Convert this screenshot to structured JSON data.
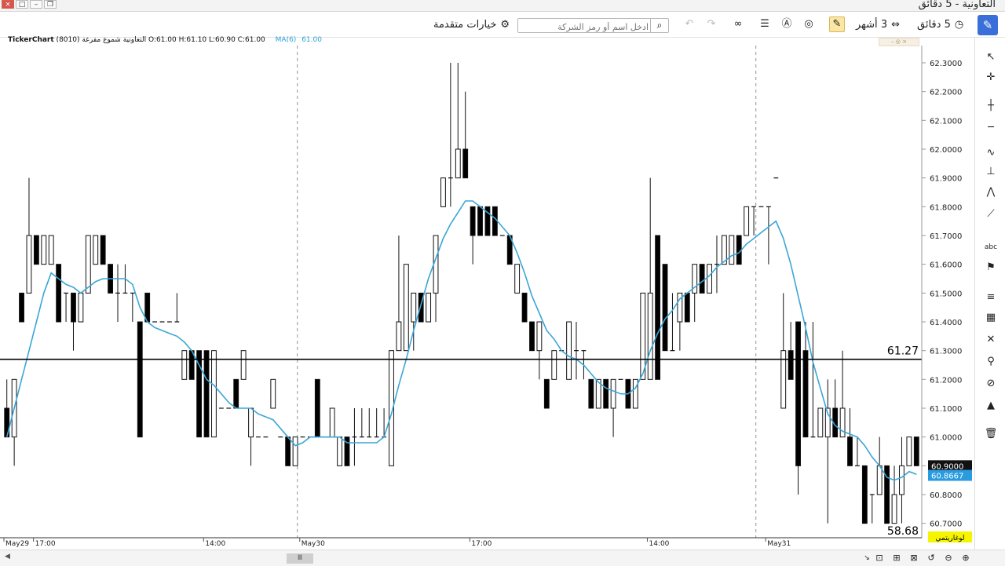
{
  "window": {
    "title": "التعاونية - 5 دقائق",
    "controls": [
      "×",
      "□",
      "–",
      "❐"
    ]
  },
  "toolbar": {
    "interval_label": "5 دقائق",
    "range_label": "3 أشهر",
    "search_placeholder": "ادخل اسم أو رمز الشركة",
    "advanced_options_label": "خيارات متقدمة",
    "icons": [
      "clock-icon",
      "range-icon",
      "draw-active-icon",
      "indicator-icon",
      "alert-icon",
      "list-icon",
      "binoculars-icon",
      "redo-icon",
      "undo-icon",
      "search-icon",
      "settings-icon"
    ]
  },
  "info": {
    "brand": "TickerChart",
    "description": "التعاونية شموع مفرغة (8010) O:61.00 H:61.10 L:60.90 C:61.00",
    "ma_label": "MA(6)",
    "ma_value": "61.00"
  },
  "sidebar_icons": [
    "cursor-icon",
    "crosshair-icon",
    "vertical-line-icon",
    "horizontal-line-icon",
    "curve-icon",
    "measure-icon",
    "pattern-icon",
    "trend-icon",
    "text-icon",
    "flag-icon",
    "layers-icon",
    "grid-icon",
    "clear-drawings-icon",
    "magnet-icon",
    "hide-icon",
    "lock-icon",
    "delete-icon"
  ],
  "bottom_icons": [
    "zoom-box-icon",
    "zoom-box2-icon",
    "zoom-fit-icon",
    "zoom-reset-icon",
    "zoom-out-icon",
    "zoom-in-icon"
  ],
  "colors": {
    "ma": "#3ba6d6",
    "price_tag": "#111111",
    "ma_tag": "#2b9be0",
    "log_tag": "#f5f500"
  },
  "chart_data": {
    "type": "candlestick",
    "subtype": "hollow",
    "ylim": [
      60.65,
      62.36
    ],
    "y_ticks": [
      "62.3000",
      "62.2000",
      "62.1000",
      "62.0000",
      "61.9000",
      "61.8000",
      "61.7000",
      "61.6000",
      "61.5000",
      "61.4000",
      "61.3000",
      "61.2000",
      "61.1000",
      "61.0000",
      "60.9000",
      "60.8000",
      "60.7000"
    ],
    "x_labels": [
      {
        "label": "May29",
        "index": 0
      },
      {
        "label": "17:00",
        "index": 4
      },
      {
        "label": "14:00",
        "index": 27
      },
      {
        "label": "May30",
        "index": 40
      },
      {
        "label": "17:00",
        "index": 63
      },
      {
        "label": "14:00",
        "index": 87
      },
      {
        "label": "May31",
        "index": 103
      }
    ],
    "day_separators": [
      40,
      102
    ],
    "hline": {
      "value": 61.27,
      "label": "61.27"
    },
    "bottom_value_label": "58.68",
    "last_price": "60.9000",
    "last_ma": "60.8667",
    "scale_mode_label": "لوغاريتمي",
    "candles": [
      [
        61.1,
        61.2,
        61.0,
        61.0
      ],
      [
        61.0,
        61.2,
        60.9,
        61.2
      ],
      [
        61.5,
        61.5,
        61.4,
        61.4
      ],
      [
        61.5,
        61.9,
        61.5,
        61.7
      ],
      [
        61.7,
        61.7,
        61.6,
        61.6
      ],
      [
        61.6,
        61.7,
        61.6,
        61.7
      ],
      [
        61.6,
        61.7,
        61.6,
        61.7
      ],
      [
        61.6,
        61.6,
        61.4,
        61.4
      ],
      [
        61.5,
        61.5,
        61.4,
        61.5
      ],
      [
        61.5,
        61.5,
        61.3,
        61.4
      ],
      [
        61.4,
        61.5,
        61.4,
        61.5
      ],
      [
        61.5,
        61.7,
        61.5,
        61.7
      ],
      [
        61.6,
        61.7,
        61.6,
        61.7
      ],
      [
        61.7,
        61.7,
        61.6,
        61.6
      ],
      [
        61.6,
        61.6,
        61.5,
        61.5
      ],
      [
        61.5,
        61.6,
        61.4,
        61.5
      ],
      [
        61.5,
        61.6,
        61.5,
        61.5
      ],
      [
        61.5,
        61.5,
        61.4,
        61.5
      ],
      [
        61.4,
        61.4,
        61.0,
        61.0
      ],
      [
        61.5,
        61.5,
        61.4,
        61.4
      ],
      [
        61.4,
        61.4,
        61.4,
        61.4
      ],
      [
        61.4,
        61.4,
        61.4,
        61.4
      ],
      [
        61.4,
        61.4,
        61.4,
        61.4
      ],
      [
        61.4,
        61.5,
        61.4,
        61.4
      ],
      [
        61.2,
        61.3,
        61.2,
        61.3
      ],
      [
        61.3,
        61.3,
        61.2,
        61.2
      ],
      [
        61.3,
        61.3,
        61.0,
        61.0
      ],
      [
        61.3,
        61.3,
        61.0,
        61.0
      ],
      [
        61.0,
        61.3,
        61.0,
        61.3
      ],
      [
        61.1,
        61.1,
        61.1,
        61.1
      ],
      [
        61.1,
        61.1,
        61.1,
        61.1
      ],
      [
        61.2,
        61.2,
        61.1,
        61.1
      ],
      [
        61.2,
        61.3,
        61.2,
        61.3
      ],
      [
        61.0,
        61.1,
        60.9,
        61.1
      ],
      [
        61.0,
        61.0,
        61.0,
        61.0
      ],
      [
        61.0,
        61.0,
        61.0,
        61.0
      ],
      [
        61.1,
        61.2,
        61.1,
        61.2
      ],
      [
        61.0,
        61.0,
        61.0,
        61.0
      ],
      [
        61.0,
        61.0,
        60.9,
        60.9
      ],
      [
        60.9,
        61.0,
        60.9,
        61.0
      ],
      [
        61.0,
        61.0,
        61.0,
        61.0
      ],
      [
        61.0,
        61.0,
        61.0,
        61.0
      ],
      [
        61.2,
        61.2,
        61.0,
        61.0
      ],
      [
        61.0,
        61.0,
        61.0,
        61.0
      ],
      [
        61.0,
        61.1,
        61.0,
        61.1
      ],
      [
        60.9,
        61.0,
        60.9,
        61.0
      ],
      [
        61.0,
        61.0,
        60.9,
        60.9
      ],
      [
        61.0,
        61.1,
        60.9,
        61.0
      ],
      [
        61.0,
        61.1,
        61.0,
        61.0
      ],
      [
        61.0,
        61.1,
        61.0,
        61.0
      ],
      [
        61.0,
        61.1,
        61.0,
        61.0
      ],
      [
        61.0,
        61.1,
        61.0,
        61.0
      ],
      [
        60.9,
        61.3,
        60.9,
        61.3
      ],
      [
        61.3,
        61.7,
        61.3,
        61.4
      ],
      [
        61.3,
        61.6,
        61.3,
        61.6
      ],
      [
        61.4,
        61.5,
        61.3,
        61.5
      ],
      [
        61.5,
        61.5,
        61.4,
        61.4
      ],
      [
        61.4,
        61.5,
        61.4,
        61.5
      ],
      [
        61.5,
        61.7,
        61.4,
        61.7
      ],
      [
        61.8,
        61.9,
        61.8,
        61.9
      ],
      [
        61.9,
        62.3,
        61.8,
        61.9
      ],
      [
        61.9,
        62.3,
        61.9,
        62.0
      ],
      [
        62.0,
        62.2,
        61.9,
        61.9
      ],
      [
        61.8,
        61.8,
        61.6,
        61.7
      ],
      [
        61.8,
        61.8,
        61.7,
        61.7
      ],
      [
        61.8,
        61.8,
        61.7,
        61.7
      ],
      [
        61.8,
        61.8,
        61.7,
        61.7
      ],
      [
        61.7,
        61.7,
        61.7,
        61.7
      ],
      [
        61.7,
        61.7,
        61.6,
        61.6
      ],
      [
        61.5,
        61.6,
        61.5,
        61.6
      ],
      [
        61.5,
        61.5,
        61.4,
        61.4
      ],
      [
        61.4,
        61.4,
        61.3,
        61.3
      ],
      [
        61.3,
        61.4,
        61.2,
        61.4
      ],
      [
        61.2,
        61.2,
        61.1,
        61.1
      ],
      [
        61.2,
        61.3,
        61.2,
        61.3
      ],
      [
        61.3,
        61.3,
        61.3,
        61.3
      ],
      [
        61.2,
        61.4,
        61.2,
        61.4
      ],
      [
        61.3,
        61.4,
        61.2,
        61.3
      ],
      [
        61.3,
        61.3,
        61.2,
        61.3
      ],
      [
        61.2,
        61.2,
        61.1,
        61.1
      ],
      [
        61.1,
        61.2,
        61.1,
        61.2
      ],
      [
        61.2,
        61.2,
        61.1,
        61.1
      ],
      [
        61.1,
        61.2,
        61.0,
        61.2
      ],
      [
        61.2,
        61.2,
        61.2,
        61.2
      ],
      [
        61.2,
        61.2,
        61.1,
        61.1
      ],
      [
        61.1,
        61.2,
        61.1,
        61.2
      ],
      [
        61.2,
        61.5,
        61.2,
        61.5
      ],
      [
        61.2,
        61.9,
        61.2,
        61.5
      ],
      [
        61.7,
        61.7,
        61.2,
        61.2
      ],
      [
        61.6,
        61.6,
        61.3,
        61.3
      ],
      [
        61.3,
        61.5,
        61.3,
        61.3
      ],
      [
        61.4,
        61.5,
        61.3,
        61.5
      ],
      [
        61.5,
        61.5,
        61.4,
        61.4
      ],
      [
        61.5,
        61.6,
        61.4,
        61.6
      ],
      [
        61.6,
        61.6,
        61.5,
        61.5
      ],
      [
        61.5,
        61.6,
        61.5,
        61.6
      ],
      [
        61.6,
        61.7,
        61.5,
        61.6
      ],
      [
        61.6,
        61.7,
        61.6,
        61.7
      ],
      [
        61.6,
        61.7,
        61.6,
        61.7
      ],
      [
        61.7,
        61.7,
        61.6,
        61.6
      ],
      [
        61.7,
        61.8,
        61.7,
        61.8
      ],
      [
        61.8,
        61.8,
        61.7,
        61.8
      ],
      [
        61.8,
        61.8,
        61.8,
        61.8
      ],
      [
        61.8,
        61.8,
        61.6,
        61.8
      ],
      [
        61.9,
        61.9,
        61.9,
        61.9
      ],
      [
        61.1,
        61.5,
        61.1,
        61.3
      ],
      [
        61.3,
        61.4,
        61.2,
        61.2
      ],
      [
        61.4,
        61.4,
        60.8,
        60.9
      ],
      [
        61.3,
        61.4,
        61.0,
        61.0
      ],
      [
        61.0,
        61.4,
        61.0,
        61.0
      ],
      [
        61.0,
        61.1,
        61.0,
        61.1
      ],
      [
        61.0,
        61.2,
        60.7,
        61.1
      ],
      [
        61.1,
        61.2,
        61.0,
        61.0
      ],
      [
        61.0,
        61.3,
        61.0,
        61.1
      ],
      [
        61.0,
        61.1,
        60.9,
        60.9
      ],
      [
        60.9,
        61.0,
        60.9,
        60.9
      ],
      [
        60.9,
        60.9,
        60.7,
        60.7
      ],
      [
        60.8,
        60.8,
        60.7,
        60.8
      ],
      [
        60.8,
        61.0,
        60.8,
        60.9
      ],
      [
        60.9,
        60.9,
        60.7,
        60.7
      ],
      [
        60.7,
        60.9,
        60.7,
        60.8
      ],
      [
        60.8,
        61.0,
        60.7,
        60.9
      ],
      [
        60.9,
        61.0,
        60.9,
        61.0
      ],
      [
        61.0,
        61.0,
        60.9,
        60.9
      ]
    ],
    "ma_values": [
      61.0,
      61.1,
      61.2,
      61.3,
      61.4,
      61.5,
      61.57,
      61.55,
      61.53,
      61.52,
      61.5,
      61.52,
      61.54,
      61.55,
      61.55,
      61.55,
      61.55,
      61.53,
      61.45,
      61.4,
      61.38,
      61.37,
      61.36,
      61.35,
      61.33,
      61.3,
      61.25,
      61.2,
      61.18,
      61.15,
      61.12,
      61.1,
      61.1,
      61.1,
      61.08,
      61.07,
      61.06,
      61.03,
      61.0,
      60.97,
      60.98,
      61.0,
      61.0,
      61.0,
      61.0,
      61.0,
      60.98,
      60.98,
      60.98,
      60.98,
      60.98,
      61.0,
      61.08,
      61.18,
      61.27,
      61.37,
      61.46,
      61.55,
      61.62,
      61.69,
      61.74,
      61.78,
      61.82,
      61.82,
      61.8,
      61.78,
      61.76,
      61.73,
      61.7,
      61.64,
      61.57,
      61.49,
      61.43,
      61.37,
      61.34,
      61.3,
      61.28,
      61.27,
      61.25,
      61.22,
      61.19,
      61.17,
      61.16,
      61.15,
      61.15,
      61.17,
      61.22,
      61.3,
      61.36,
      61.41,
      61.44,
      61.48,
      61.5,
      61.52,
      61.54,
      61.56,
      61.59,
      61.61,
      61.63,
      61.64,
      61.67,
      61.69,
      61.71,
      61.73,
      61.75,
      61.69,
      61.6,
      61.49,
      61.38,
      61.26,
      61.17,
      61.08,
      61.04,
      61.02,
      61.01,
      61.0,
      60.97,
      60.93,
      60.9,
      60.86,
      60.85,
      60.86,
      60.88,
      60.87
    ]
  }
}
